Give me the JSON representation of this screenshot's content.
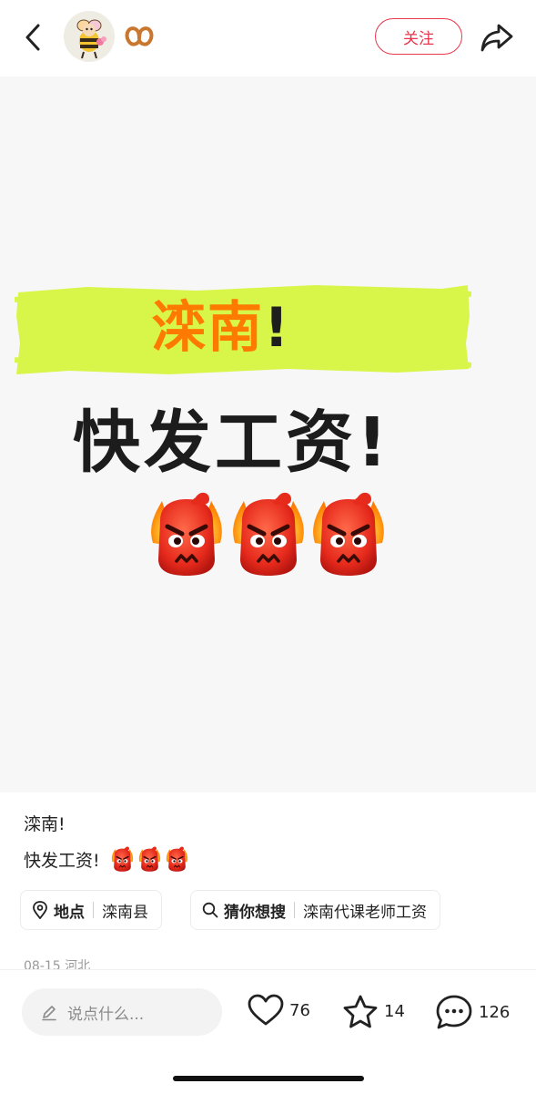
{
  "header": {
    "back_icon": "chevron-left-icon",
    "avatar": "bee-avatar",
    "badge_icon": "pretzel-icon",
    "follow_label": "关注",
    "share_icon": "share-icon",
    "accent": "#e8364d"
  },
  "image": {
    "line1_main": "滦南",
    "line1_excl": "!",
    "line2": "快发工资!",
    "emoji": "angry-face",
    "highlight_color": "#d8f64a"
  },
  "post": {
    "line1": "滦南!",
    "line2": "快发工资!",
    "tags": [
      {
        "icon": "location-pin-icon",
        "key": "地点",
        "value": "滦南县"
      },
      {
        "icon": "search-icon",
        "key": "猜你想搜",
        "value": "滦南代课老师工资"
      }
    ],
    "date": "08-15 河北"
  },
  "footer": {
    "comment_placeholder": "说点什么...",
    "likes": "76",
    "stars": "14",
    "comments": "126"
  }
}
